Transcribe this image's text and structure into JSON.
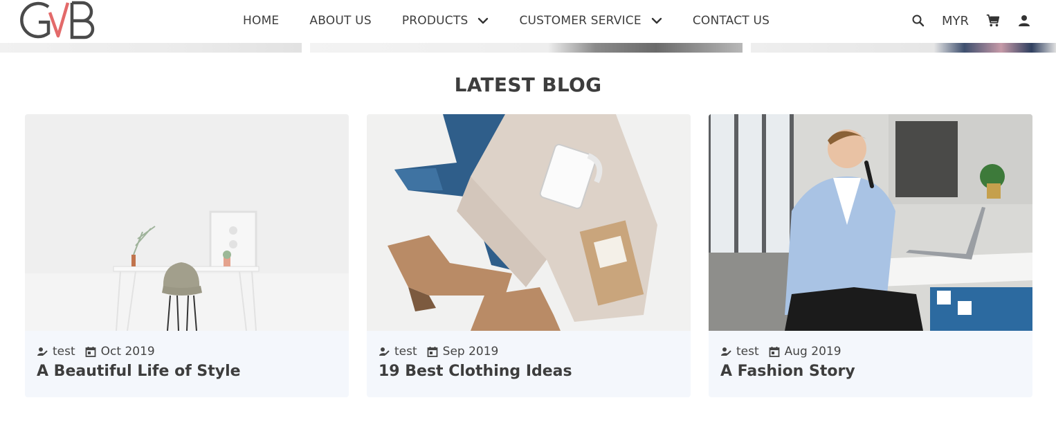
{
  "brand": {
    "logo_text": "GVB",
    "accent": "#e36a6a",
    "ink": "#444444"
  },
  "nav": {
    "items": [
      {
        "label": "HOME",
        "has_dropdown": false
      },
      {
        "label": "ABOUT US",
        "has_dropdown": false
      },
      {
        "label": "PRODUCTS",
        "has_dropdown": true
      },
      {
        "label": "CUSTOMER SERVICE",
        "has_dropdown": true
      },
      {
        "label": "CONTACT US",
        "has_dropdown": false
      }
    ]
  },
  "tools": {
    "search_icon": "search-icon",
    "currency": "MYR",
    "cart_icon": "cart-icon",
    "account_icon": "user-icon"
  },
  "blog": {
    "section_title": "LATEST BLOG",
    "card_bg": "#f4f7fc",
    "posts": [
      {
        "author": "test",
        "date": "Oct 2019",
        "title": "A Beautiful Life of Style",
        "image": "white-room-desk-chair"
      },
      {
        "author": "test",
        "date": "Sep 2019",
        "title": "19 Best Clothing Ideas",
        "image": "flatlay-jeans-sweater-boots-mug"
      },
      {
        "author": "test",
        "date": "Aug 2019",
        "title": "A Fashion Story",
        "image": "man-in-blue-blazer-on-phone-cafe"
      }
    ]
  }
}
